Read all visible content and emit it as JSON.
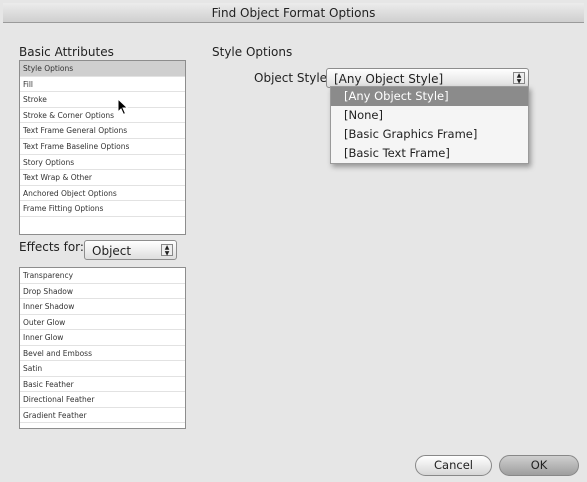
{
  "window": {
    "title": "Find Object Format Options"
  },
  "basic_attributes": {
    "heading": "Basic Attributes",
    "items": [
      {
        "label": "Style Options",
        "selected": true
      },
      {
        "label": "Fill"
      },
      {
        "label": "Stroke"
      },
      {
        "label": "Stroke & Corner Options"
      },
      {
        "label": "Text Frame General Options"
      },
      {
        "label": "Text Frame Baseline Options"
      },
      {
        "label": "Story Options"
      },
      {
        "label": "Text Wrap & Other"
      },
      {
        "label": "Anchored Object Options"
      },
      {
        "label": "Frame Fitting Options"
      }
    ]
  },
  "effects": {
    "label": "Effects for:",
    "selected": "Object",
    "items": [
      "Transparency",
      "Drop Shadow",
      "Inner Shadow",
      "Outer Glow",
      "Inner Glow",
      "Bevel and Emboss",
      "Satin",
      "Basic Feather",
      "Directional Feather",
      "Gradient Feather"
    ]
  },
  "style_options": {
    "heading": "Style Options",
    "object_style_label": "Object Style:",
    "object_style_value": "[Any Object Style]",
    "menu_items": [
      "[Any Object Style]",
      "[None]",
      "[Basic Graphics Frame]",
      "[Basic Text Frame]"
    ],
    "highlighted_index": 0
  },
  "buttons": {
    "cancel": "Cancel",
    "ok": "OK"
  }
}
